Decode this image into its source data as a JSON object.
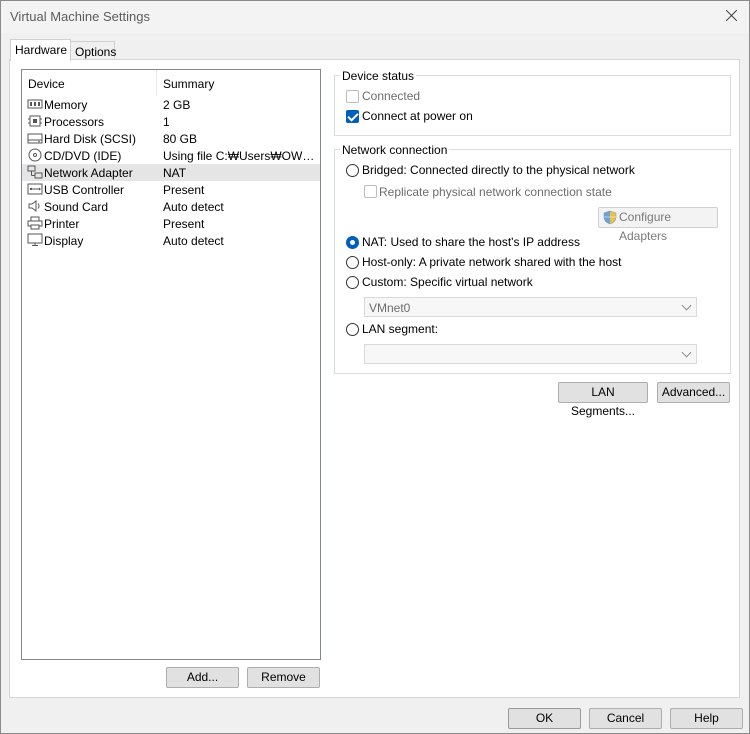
{
  "window": {
    "title": "Virtual Machine Settings"
  },
  "tabs": [
    {
      "label": "Hardware"
    },
    {
      "label": "Options"
    }
  ],
  "device_list": {
    "columns": {
      "device": "Device",
      "summary": "Summary"
    },
    "rows": [
      {
        "name": "Memory",
        "summary": "2 GB",
        "icon": "memory-icon"
      },
      {
        "name": "Processors",
        "summary": "1",
        "icon": "processor-icon"
      },
      {
        "name": "Hard Disk (SCSI)",
        "summary": "80 GB",
        "icon": "hard-disk-icon"
      },
      {
        "name": "CD/DVD (IDE)",
        "summary": "Using file C:₩Users₩OWNE...",
        "icon": "cd-dvd-icon"
      },
      {
        "name": "Network Adapter",
        "summary": "NAT",
        "icon": "network-adapter-icon"
      },
      {
        "name": "USB Controller",
        "summary": "Present",
        "icon": "usb-icon"
      },
      {
        "name": "Sound Card",
        "summary": "Auto detect",
        "icon": "speaker-icon"
      },
      {
        "name": "Printer",
        "summary": "Present",
        "icon": "printer-icon"
      },
      {
        "name": "Display",
        "summary": "Auto detect",
        "icon": "monitor-icon"
      }
    ],
    "selected_index": 4
  },
  "list_buttons": {
    "add": "Add...",
    "remove": "Remove"
  },
  "device_status": {
    "label": "Device status",
    "connected": {
      "label": "Connected",
      "checked": false,
      "enabled": false
    },
    "connect_at_power_on": {
      "label": "Connect at power on",
      "checked": true
    }
  },
  "network_connection": {
    "label": "Network connection",
    "bridged": "Bridged: Connected directly to the physical network",
    "replicate": "Replicate physical network connection state",
    "configure_adapters": "Configure Adapters",
    "nat": "NAT: Used to share the host's IP address",
    "host_only": "Host-only: A private network shared with the host",
    "custom": "Custom: Specific virtual network",
    "custom_value": "VMnet0",
    "lan_segment": "LAN segment:",
    "lan_segment_value": "",
    "selected": "nat"
  },
  "network_buttons": {
    "lan_segments": "LAN Segments...",
    "advanced": "Advanced..."
  },
  "footer": {
    "ok": "OK",
    "cancel": "Cancel",
    "help": "Help"
  },
  "colors": {
    "accent": "#005fb8",
    "selected_row": "#e5e5e5",
    "window_bg": "#f0f0f0"
  }
}
